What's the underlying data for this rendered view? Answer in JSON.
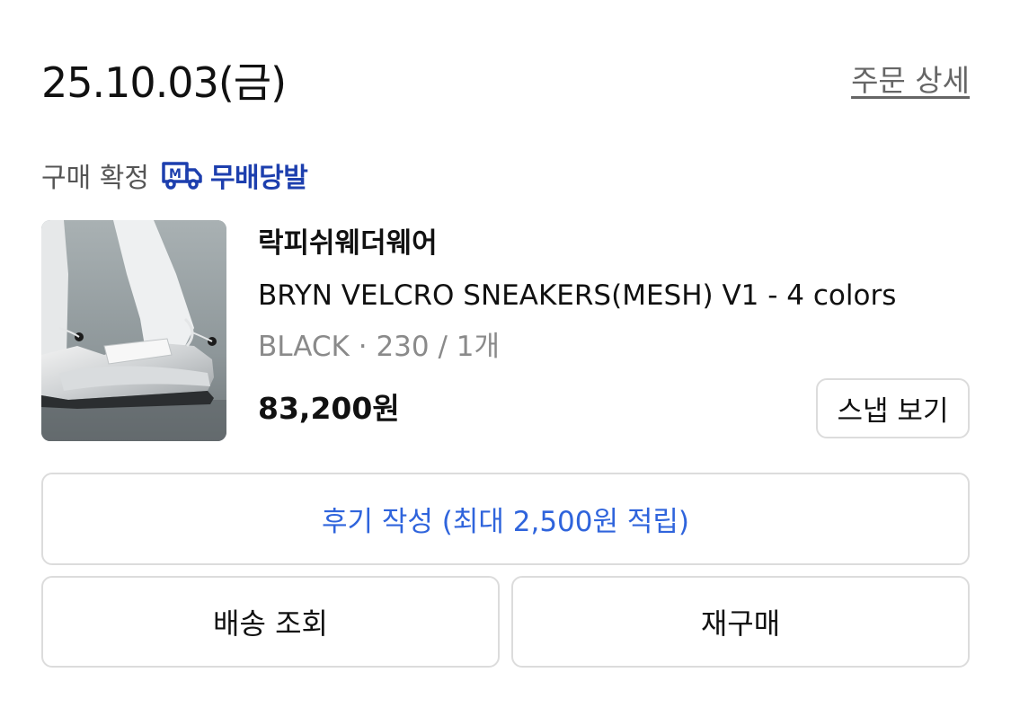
{
  "order": {
    "date": "25.10.03(금)",
    "detail_link": "주문 상세"
  },
  "status": {
    "label": "구매 확정",
    "delivery_icon": "truck-m-icon",
    "delivery_badge": "무배당발",
    "badge_color": "#1D3FAE"
  },
  "product": {
    "image": "sneaker-photo",
    "brand": "락피쉬웨더웨어",
    "name": "BRYN VELCRO SNEAKERS(MESH) V1 - 4 colors",
    "option": "BLACK · 230 / 1개",
    "price": "83,200원",
    "snap_button": "스냅 보기"
  },
  "actions": {
    "review": "후기 작성 (최대 2,500원 적립)",
    "tracking": "배송 조회",
    "reorder": "재구매",
    "review_color": "#2F64DC"
  }
}
